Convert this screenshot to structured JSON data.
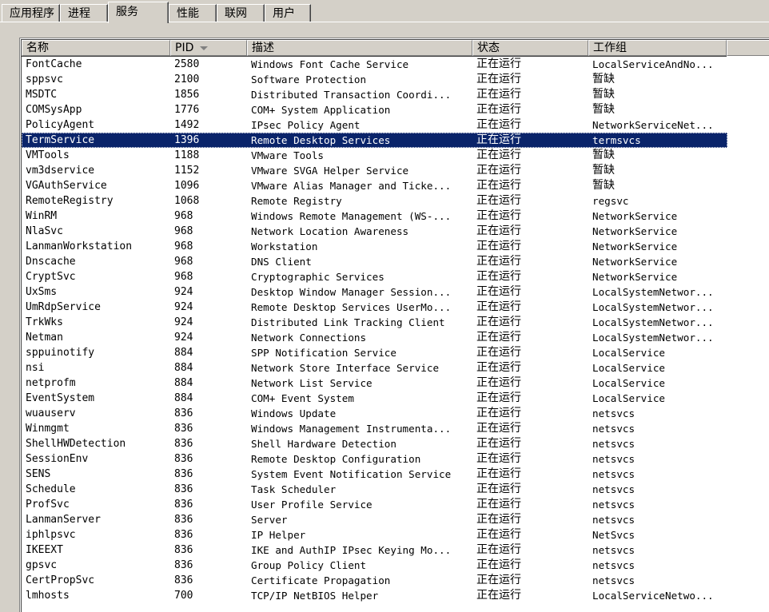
{
  "tabs": [
    {
      "label": "应用程序",
      "active": false
    },
    {
      "label": "进程",
      "active": false
    },
    {
      "label": "服务",
      "active": true
    },
    {
      "label": "性能",
      "active": false
    },
    {
      "label": "联网",
      "active": false
    },
    {
      "label": "用户",
      "active": false
    }
  ],
  "columns": {
    "name": "名称",
    "pid": "PID",
    "description": "描述",
    "status": "状态",
    "group": "工作组"
  },
  "sort": {
    "column": "pid",
    "direction": "descending"
  },
  "selection_color": "#0a246a",
  "services": [
    {
      "name": "FontCache",
      "pid": "2580",
      "description": "Windows Font Cache Service",
      "status": "正在运行",
      "group": "LocalServiceAndNo..."
    },
    {
      "name": "sppsvc",
      "pid": "2100",
      "description": "Software Protection",
      "status": "正在运行",
      "group": "暂缺"
    },
    {
      "name": "MSDTC",
      "pid": "1856",
      "description": "Distributed Transaction Coordi...",
      "status": "正在运行",
      "group": "暂缺"
    },
    {
      "name": "COMSysApp",
      "pid": "1776",
      "description": "COM+ System Application",
      "status": "正在运行",
      "group": "暂缺"
    },
    {
      "name": "PolicyAgent",
      "pid": "1492",
      "description": "IPsec Policy Agent",
      "status": "正在运行",
      "group": "NetworkServiceNet..."
    },
    {
      "name": "TermService",
      "pid": "1396",
      "description": "Remote Desktop Services",
      "status": "正在运行",
      "group": "termsvcs",
      "selected": true
    },
    {
      "name": "VMTools",
      "pid": "1188",
      "description": "VMware Tools",
      "status": "正在运行",
      "group": "暂缺"
    },
    {
      "name": "vm3dservice",
      "pid": "1152",
      "description": "VMware SVGA Helper Service",
      "status": "正在运行",
      "group": "暂缺"
    },
    {
      "name": "VGAuthService",
      "pid": "1096",
      "description": "VMware Alias Manager and Ticke...",
      "status": "正在运行",
      "group": "暂缺"
    },
    {
      "name": "RemoteRegistry",
      "pid": "1068",
      "description": "Remote Registry",
      "status": "正在运行",
      "group": "regsvc"
    },
    {
      "name": "WinRM",
      "pid": "968",
      "description": "Windows Remote Management (WS-...",
      "status": "正在运行",
      "group": "NetworkService"
    },
    {
      "name": "NlaSvc",
      "pid": "968",
      "description": "Network Location Awareness",
      "status": "正在运行",
      "group": "NetworkService"
    },
    {
      "name": "LanmanWorkstation",
      "pid": "968",
      "description": "Workstation",
      "status": "正在运行",
      "group": "NetworkService"
    },
    {
      "name": "Dnscache",
      "pid": "968",
      "description": "DNS Client",
      "status": "正在运行",
      "group": "NetworkService"
    },
    {
      "name": "CryptSvc",
      "pid": "968",
      "description": "Cryptographic Services",
      "status": "正在运行",
      "group": "NetworkService"
    },
    {
      "name": "UxSms",
      "pid": "924",
      "description": "Desktop Window Manager Session...",
      "status": "正在运行",
      "group": "LocalSystemNetwor..."
    },
    {
      "name": "UmRdpService",
      "pid": "924",
      "description": "Remote Desktop Services UserMo...",
      "status": "正在运行",
      "group": "LocalSystemNetwor..."
    },
    {
      "name": "TrkWks",
      "pid": "924",
      "description": "Distributed Link Tracking Client",
      "status": "正在运行",
      "group": "LocalSystemNetwor..."
    },
    {
      "name": "Netman",
      "pid": "924",
      "description": "Network Connections",
      "status": "正在运行",
      "group": "LocalSystemNetwor..."
    },
    {
      "name": "sppuinotify",
      "pid": "884",
      "description": "SPP Notification Service",
      "status": "正在运行",
      "group": "LocalService"
    },
    {
      "name": "nsi",
      "pid": "884",
      "description": "Network Store Interface Service",
      "status": "正在运行",
      "group": "LocalService"
    },
    {
      "name": "netprofm",
      "pid": "884",
      "description": "Network List Service",
      "status": "正在运行",
      "group": "LocalService"
    },
    {
      "name": "EventSystem",
      "pid": "884",
      "description": "COM+ Event System",
      "status": "正在运行",
      "group": "LocalService"
    },
    {
      "name": "wuauserv",
      "pid": "836",
      "description": "Windows Update",
      "status": "正在运行",
      "group": "netsvcs"
    },
    {
      "name": "Winmgmt",
      "pid": "836",
      "description": "Windows Management Instrumenta...",
      "status": "正在运行",
      "group": "netsvcs"
    },
    {
      "name": "ShellHWDetection",
      "pid": "836",
      "description": "Shell Hardware Detection",
      "status": "正在运行",
      "group": "netsvcs"
    },
    {
      "name": "SessionEnv",
      "pid": "836",
      "description": "Remote Desktop Configuration",
      "status": "正在运行",
      "group": "netsvcs"
    },
    {
      "name": "SENS",
      "pid": "836",
      "description": "System Event Notification Service",
      "status": "正在运行",
      "group": "netsvcs"
    },
    {
      "name": "Schedule",
      "pid": "836",
      "description": "Task Scheduler",
      "status": "正在运行",
      "group": "netsvcs"
    },
    {
      "name": "ProfSvc",
      "pid": "836",
      "description": "User Profile Service",
      "status": "正在运行",
      "group": "netsvcs"
    },
    {
      "name": "LanmanServer",
      "pid": "836",
      "description": "Server",
      "status": "正在运行",
      "group": "netsvcs"
    },
    {
      "name": "iphlpsvc",
      "pid": "836",
      "description": "IP Helper",
      "status": "正在运行",
      "group": "NetSvcs"
    },
    {
      "name": "IKEEXT",
      "pid": "836",
      "description": "IKE and AuthIP IPsec Keying Mo...",
      "status": "正在运行",
      "group": "netsvcs"
    },
    {
      "name": "gpsvc",
      "pid": "836",
      "description": "Group Policy Client",
      "status": "正在运行",
      "group": "netsvcs"
    },
    {
      "name": "CertPropSvc",
      "pid": "836",
      "description": "Certificate Propagation",
      "status": "正在运行",
      "group": "netsvcs"
    },
    {
      "name": "lmhosts",
      "pid": "700",
      "description": "TCP/IP NetBIOS Helper",
      "status": "正在运行",
      "group": "LocalServiceNetwo..."
    }
  ]
}
